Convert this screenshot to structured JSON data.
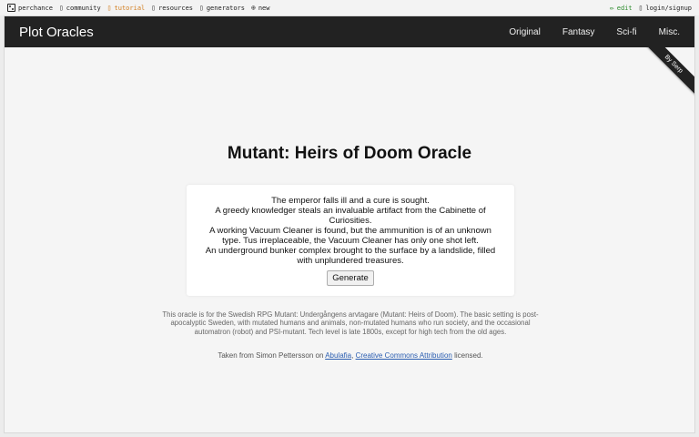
{
  "topbar": {
    "perchance": "perchance",
    "community": "community",
    "tutorial": "tutorial",
    "resources": "resources",
    "generators": "generators",
    "new": "new",
    "edit": "edit",
    "login": "login/signup",
    "new_icon": "⊕",
    "edit_icon": "✏",
    "sep_icon": "▯",
    "tutorial_color": "#d27d1e",
    "edit_color": "#2f8d2f"
  },
  "navbar": {
    "brand": "Plot Oracles",
    "items": [
      "Original",
      "Fantasy",
      "Sci-fi",
      "Misc."
    ],
    "background": "#222222"
  },
  "ribbon": {
    "label": "By Serp"
  },
  "main": {
    "title": "Mutant: Heirs of Doom Oracle",
    "lines": [
      "The emperor falls ill and a cure is sought.",
      "A greedy knowledger steals an invaluable artifact from the Cabinette of Curiosities.",
      "A working Vacuum Cleaner is found, but the ammunition is of an unknown type. Tus irreplaceable, the Vacuum Cleaner has only one shot left.",
      "An underground bunker complex brought to the surface by a landslide, filled with unplundered treasures."
    ],
    "generate_label": "Generate"
  },
  "footer": {
    "description": "This oracle is for the Swedish RPG Mutant: Undergångens arvtagare (Mutant: Heirs of Doom). The basic setting is post-apocalyptic Sweden, with mutated humans and animals, non-mutated humans who run society, and the occasional automatron (robot) and PSI-mutant. Tech level is late 1800s, except for high tech from the old ages.",
    "credit_prefix": "Taken from Simon Pettersson on",
    "credit_link1": "Abulafia",
    "credit_comma": ",",
    "credit_link2": "Creative Commons Attribution",
    "credit_suffix": "licensed.",
    "link_color": "#2a5db0"
  }
}
